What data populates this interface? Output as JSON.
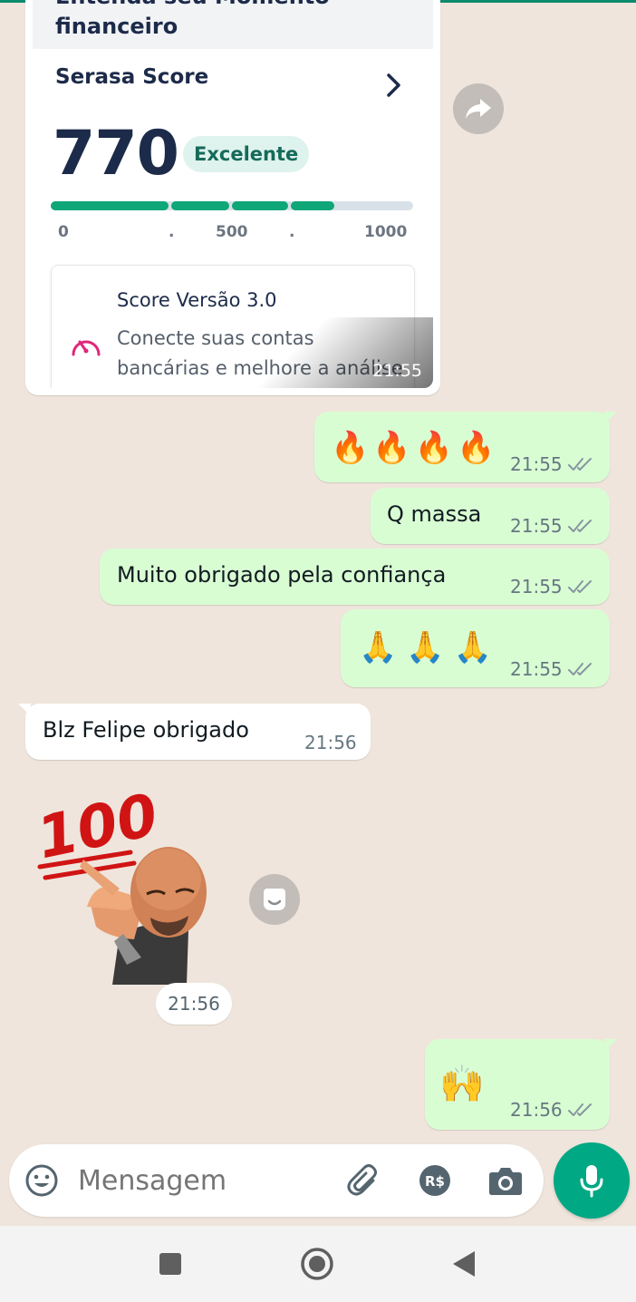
{
  "chat": {
    "shared_image": {
      "header_partial": "Entenda seu Momento",
      "header_title": "financeiro",
      "score_label": "Serasa Score",
      "score_value": "770",
      "score_badge": "Excelente",
      "score_level": 0.77,
      "scale_ticks": [
        "0",
        ".",
        "500",
        ".",
        "1000"
      ],
      "tip_title": "Score Versão 3.0",
      "tip_body": "Conecte suas contas bancárias e melhore a análise do seu Score",
      "time": "21:55"
    },
    "messages": [
      {
        "direction": "out",
        "text": "🔥🔥🔥🔥",
        "time": "21:55",
        "status": "read-double-check"
      },
      {
        "direction": "out",
        "text": "Q massa",
        "time": "21:55",
        "status": "read-double-check"
      },
      {
        "direction": "out",
        "text": "Muito obrigado pela confiança",
        "time": "21:55",
        "status": "read-double-check"
      },
      {
        "direction": "out",
        "text": "🙏🙏🙏",
        "time": "21:55",
        "status": "read-double-check"
      },
      {
        "direction": "in",
        "text": "Blz Felipe obrigado",
        "time": "21:56"
      },
      {
        "direction": "in",
        "type": "sticker",
        "text": "100",
        "time": "21:56"
      },
      {
        "direction": "out",
        "text": "🙌",
        "time": "21:56",
        "status": "read-double-check"
      }
    ]
  },
  "composer": {
    "placeholder": "Mensagem",
    "icons": [
      "emoji-icon",
      "attach-icon",
      "payment-icon",
      "camera-icon",
      "mic-icon"
    ],
    "payment_label": "R$"
  },
  "colors": {
    "outgoing_bubble": "#d9fdd3",
    "incoming_bubble": "#ffffff",
    "accent": "#00a884",
    "score_bar": "#0fa678",
    "read_check": "#8696a0"
  }
}
